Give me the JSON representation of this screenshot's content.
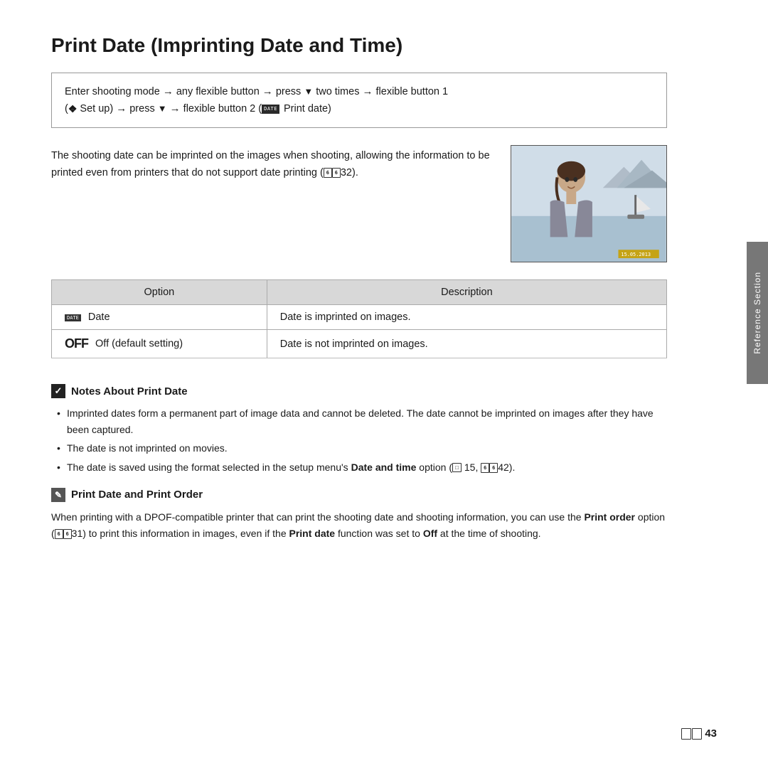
{
  "page": {
    "title": "Print Date (Imprinting Date and Time)",
    "instruction": {
      "line1": "Enter shooting mode → any flexible button → press ▼ two times → flexible button 1",
      "line2": "(❖ Set up) → press ▼ → flexible button 2 (DATE Print date)"
    },
    "description": "The shooting date can be imprinted on the images when shooting, allowing the information to be printed even from printers that do not support date printing (❻❻32).",
    "table": {
      "header_option": "Option",
      "header_description": "Description",
      "rows": [
        {
          "icon": "DATE",
          "option": "Date",
          "description": "Date is imprinted on images."
        },
        {
          "icon": "OFF",
          "option": "Off (default setting)",
          "description": "Date is not imprinted on images."
        }
      ]
    },
    "notes_section": {
      "title": "Notes About Print Date",
      "bullets": [
        "Imprinted dates form a permanent part of image data and cannot be deleted. The date cannot be imprinted on images after they have been captured.",
        "The date is not imprinted on movies.",
        "The date is saved using the format selected in the setup menu's Date and time option (□ 15, ❻❻42)."
      ]
    },
    "print_order_section": {
      "title": "Print Date and Print Order",
      "body": "When printing with a DPOF-compatible printer that can print the shooting date and shooting information, you can use the Print order option (❻❻31) to print this information in images, even if the Print date function was set to Off at the time of shooting."
    },
    "sidebar_label": "Reference Section",
    "page_number": "❻❻43"
  }
}
